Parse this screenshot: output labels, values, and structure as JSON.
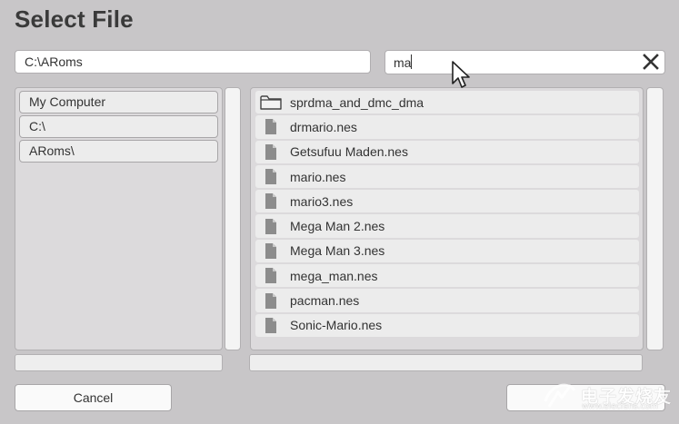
{
  "dialog": {
    "title": "Select File"
  },
  "path_field": {
    "value": "C:\\ARoms"
  },
  "search_field": {
    "value": "ma",
    "clear_icon": "close-icon"
  },
  "breadcrumb": {
    "items": [
      {
        "label": "My Computer"
      },
      {
        "label": "C:\\"
      },
      {
        "label": "ARoms\\"
      }
    ]
  },
  "files": [
    {
      "name": "sprdma_and_dmc_dma",
      "type": "folder",
      "icon": "folder-icon"
    },
    {
      "name": "drmario.nes",
      "type": "file",
      "icon": "file-icon"
    },
    {
      "name": "Getsufuu Maden.nes",
      "type": "file",
      "icon": "file-icon"
    },
    {
      "name": "mario.nes",
      "type": "file",
      "icon": "file-icon"
    },
    {
      "name": "mario3.nes",
      "type": "file",
      "icon": "file-icon"
    },
    {
      "name": "Mega Man 2.nes",
      "type": "file",
      "icon": "file-icon"
    },
    {
      "name": "Mega Man 3.nes",
      "type": "file",
      "icon": "file-icon"
    },
    {
      "name": "mega_man.nes",
      "type": "file",
      "icon": "file-icon"
    },
    {
      "name": "pacman.nes",
      "type": "file",
      "icon": "file-icon"
    },
    {
      "name": "Sonic-Mario.nes",
      "type": "file",
      "icon": "file-icon"
    }
  ],
  "buttons": {
    "cancel_label": "Cancel",
    "confirm_label": ""
  },
  "watermark": {
    "text": "电子发烧友",
    "url": "www.elecfans.com"
  },
  "colors": {
    "background": "#c8c6c8",
    "panel": "#dcdadc",
    "row": "#ececec",
    "input": "#ffffff"
  }
}
